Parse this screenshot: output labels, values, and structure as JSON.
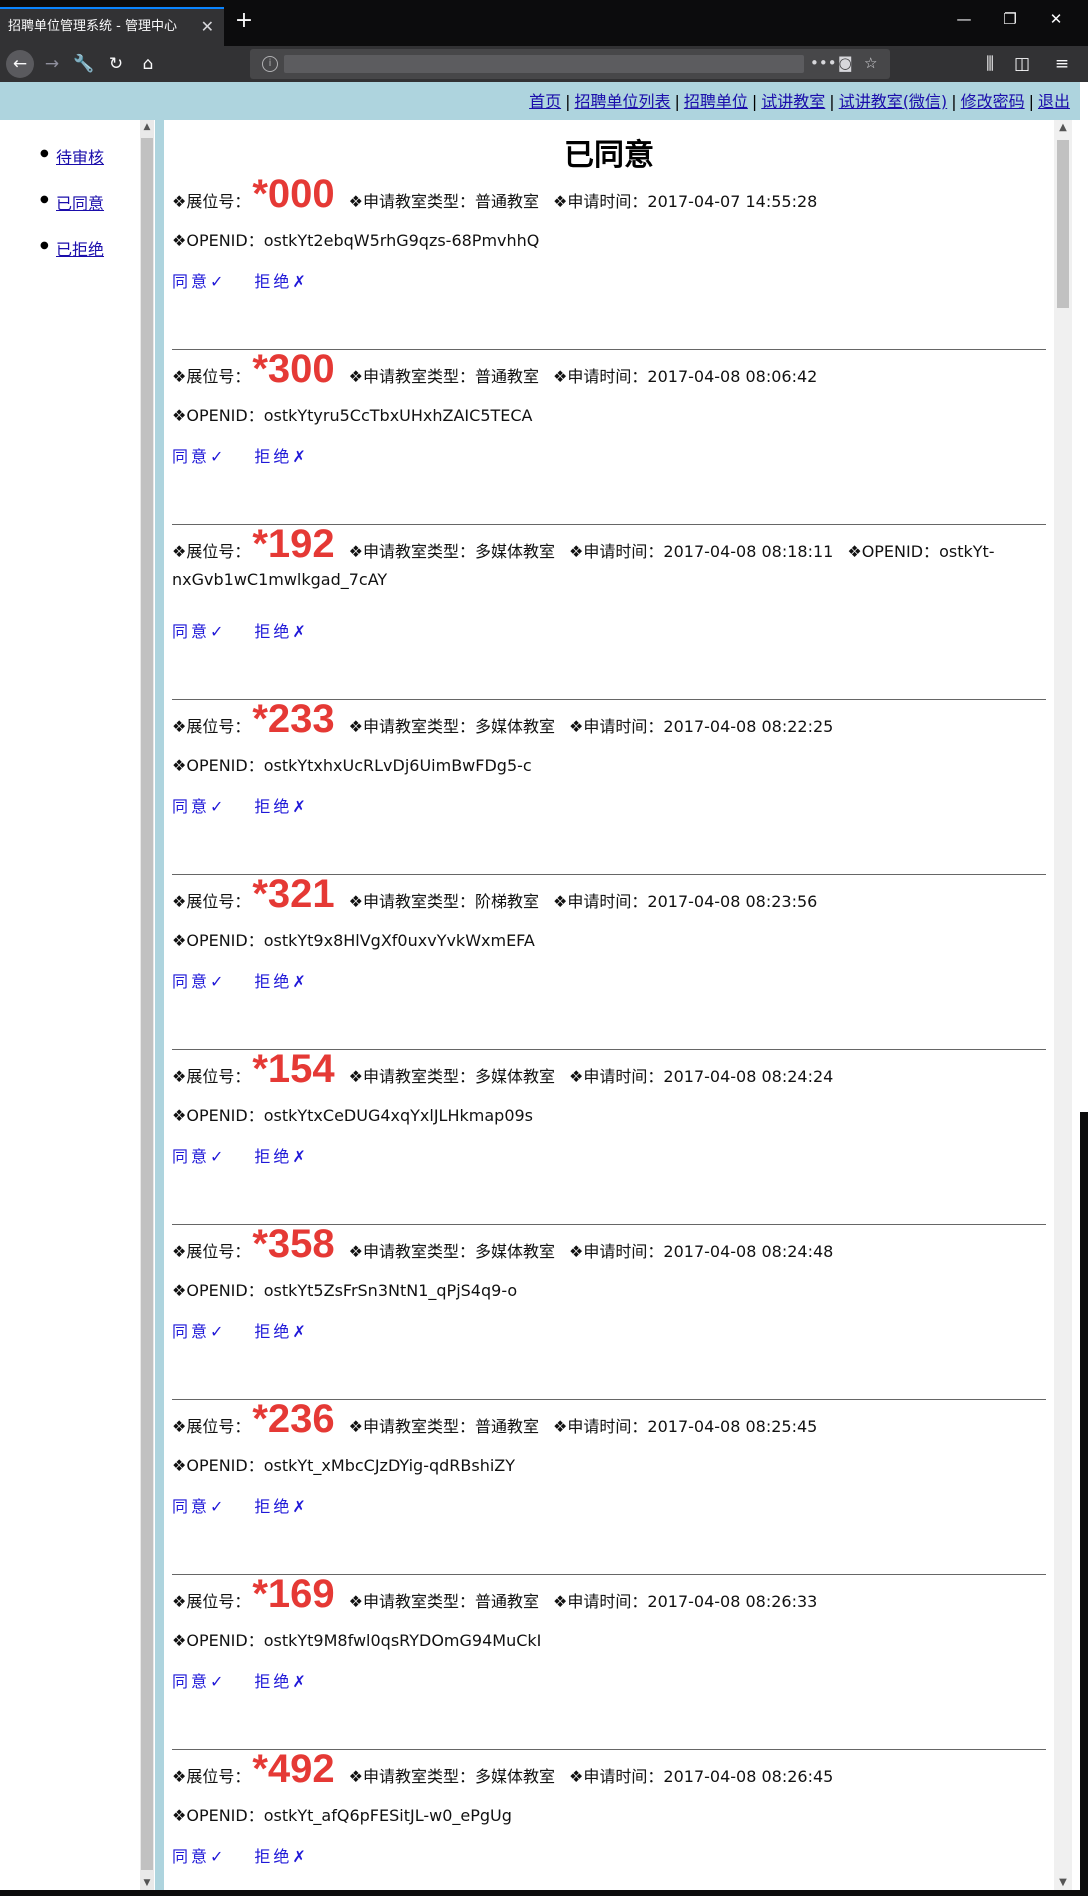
{
  "browser": {
    "tab_title": "招聘单位管理系统 - 管理中心",
    "tab_close": "✕",
    "new_tab": "+",
    "win_min": "—",
    "win_restore": "❐",
    "win_close": "✕"
  },
  "topnav": {
    "links": [
      "首页",
      "招聘单位列表",
      "招聘单位",
      "试讲教室",
      "试讲教室(微信)",
      "修改密码",
      "退出"
    ],
    "separator": "|"
  },
  "sidebar": {
    "items": [
      "待审核",
      "已同意",
      "已拒绝"
    ]
  },
  "main": {
    "title": "已同意",
    "booth_label": "❖展位号：",
    "type_label": "❖申请教室类型：",
    "time_label": "❖申请时间：",
    "openid_label": "❖OPENID：",
    "approve": "同意✓",
    "reject": "拒绝✗",
    "items": [
      {
        "booth": "*000",
        "type": "普通教室",
        "time": "2017-04-07 14:55:28",
        "openid": "ostkYt2ebqW5rhG9qzs-68PmvhhQ"
      },
      {
        "booth": "*300",
        "type": "普通教室",
        "time": "2017-04-08 08:06:42",
        "openid": "ostkYtyru5CcTbxUHxhZAIC5TECA"
      },
      {
        "booth": "*192",
        "type": "多媒体教室",
        "time": "2017-04-08 08:18:11",
        "openid": "ostkYt-nxGvb1wC1mwlkgad_7cAY"
      },
      {
        "booth": "*233",
        "type": "多媒体教室",
        "time": "2017-04-08 08:22:25",
        "openid": "ostkYtxhxUcRLvDj6UimBwFDg5-c"
      },
      {
        "booth": "*321",
        "type": "阶梯教室",
        "time": "2017-04-08 08:23:56",
        "openid": "ostkYt9x8HlVgXf0uxvYvkWxmEFA"
      },
      {
        "booth": "*154",
        "type": "多媒体教室",
        "time": "2017-04-08 08:24:24",
        "openid": "ostkYtxCeDUG4xqYxlJLHkmap09s"
      },
      {
        "booth": "*358",
        "type": "多媒体教室",
        "time": "2017-04-08 08:24:48",
        "openid": "ostkYt5ZsFrSn3NtN1_qPjS4q9-o"
      },
      {
        "booth": "*236",
        "type": "普通教室",
        "time": "2017-04-08 08:25:45",
        "openid": "ostkYt_xMbcCJzDYig-qdRBshiZY"
      },
      {
        "booth": "*169",
        "type": "普通教室",
        "time": "2017-04-08 08:26:33",
        "openid": "ostkYt9M8fwl0qsRYDOmG94MuCkI"
      },
      {
        "booth": "*492",
        "type": "多媒体教室",
        "time": "2017-04-08 08:26:45",
        "openid": "ostkYt_afQ6pFESitJL-w0_ePgUg"
      }
    ]
  }
}
